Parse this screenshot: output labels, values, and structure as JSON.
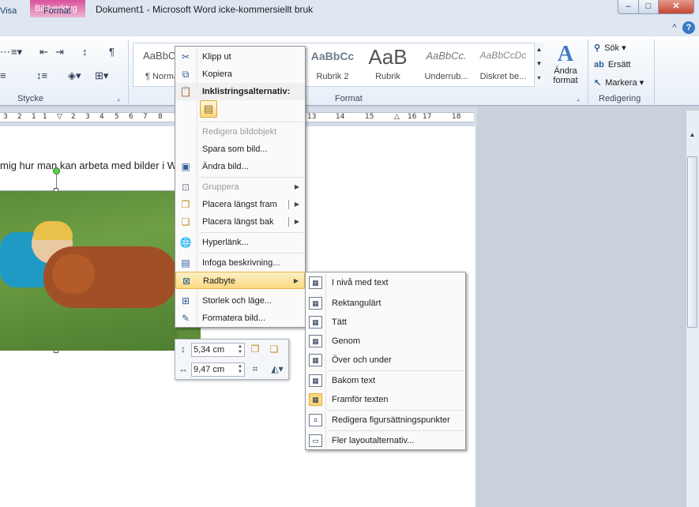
{
  "window": {
    "title": "Dokument1  -  Microsoft Word icke-kommersiellt bruk",
    "contextual_group": "Bildverktyg",
    "controls": {
      "minimize": "–",
      "maximize": "□",
      "close": "✕"
    }
  },
  "tabs": {
    "visa": "Visa",
    "format": "Format"
  },
  "ribbon": {
    "stycke_label": "Stycke",
    "format_label": "Format",
    "redigering_label": "Redigering",
    "styles": [
      {
        "sample": "AaBbCc",
        "name": "¶ Norma"
      },
      {
        "sample": "AaBbCc",
        "name": "Rubrik 2"
      },
      {
        "sample": "AaB",
        "name": "Rubrik"
      },
      {
        "sample": "AaBbCc.",
        "name": "Underrub..."
      },
      {
        "sample": "AaBbCcDc",
        "name": "Diskret be..."
      }
    ],
    "change_format": "Ändra format",
    "search": "Sök",
    "replace": "Ersätt",
    "select": "Markera",
    "collapse_glyph": "^",
    "help_glyph": "?"
  },
  "ruler": {
    "left_marks": [
      "3",
      "2",
      "1",
      "1",
      "2",
      "3",
      "4",
      "5",
      "6",
      "7",
      "8"
    ],
    "right_marks": [
      "13",
      "14",
      "15",
      "16",
      "17",
      "18"
    ]
  },
  "document": {
    "text": "mig hur man kan arbeta med bilder i W"
  },
  "context_menu": {
    "items": [
      {
        "label": "Klipp ut",
        "icon": "scissors-icon"
      },
      {
        "label": "Kopiera",
        "icon": "copy-icon"
      },
      {
        "label": "Inklistringsalternativ:",
        "icon": "paste-icon"
      },
      {
        "label": "Redigera bildobjekt"
      },
      {
        "label": "Spara som bild..."
      },
      {
        "label": "Ändra bild...",
        "icon": "change-picture-icon"
      },
      {
        "label": "Gruppera",
        "icon": "group-icon"
      },
      {
        "label": "Placera längst fram",
        "icon": "bring-front-icon"
      },
      {
        "label": "Placera längst bak",
        "icon": "send-back-icon"
      },
      {
        "label": "Hyperlänk...",
        "icon": "hyperlink-icon"
      },
      {
        "label": "Infoga beskrivning...",
        "icon": "caption-icon"
      },
      {
        "label": "Radbyte",
        "icon": "wrap-icon"
      },
      {
        "label": "Storlek och läge...",
        "icon": "size-position-icon"
      },
      {
        "label": "Formatera bild...",
        "icon": "format-picture-icon"
      }
    ]
  },
  "submenu": {
    "items": [
      {
        "label": "I nivå med text"
      },
      {
        "label": "Rektangulärt"
      },
      {
        "label": "Tätt"
      },
      {
        "label": "Genom"
      },
      {
        "label": "Över och under"
      },
      {
        "label": "Bakom text"
      },
      {
        "label": "Framför texten"
      },
      {
        "label": "Redigera figursättningspunkter"
      },
      {
        "label": "Fler layoutalternativ..."
      }
    ]
  },
  "mini_toolbar": {
    "height": "5,34 cm",
    "width": "9,47 cm"
  }
}
